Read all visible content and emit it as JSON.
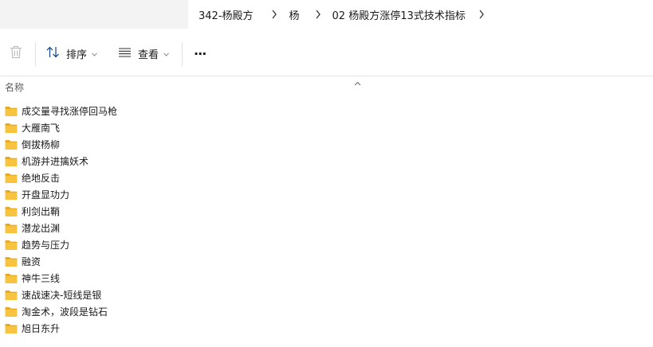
{
  "breadcrumb": [
    "342-杨殿方",
    "杨",
    "02 杨殿方涨停13式技术指标"
  ],
  "toolbar": {
    "delete_icon": "trash-icon",
    "sort_label": "排序",
    "view_label": "查看",
    "more_label": "···"
  },
  "column": {
    "name_header": "名称"
  },
  "folders": [
    "成交量寻找涨停回马枪",
    "大雁南飞",
    "倒拔杨柳",
    "机游并进擒妖术",
    "绝地反击",
    "开盘显功力",
    "利剑出鞘",
    "潜龙出渊",
    "趋势与压力",
    "融资",
    "神牛三线",
    "速战速决-短线是银",
    "淘金术，波段是钻石",
    "旭日东升"
  ],
  "colors": {
    "folder_yellow": "#f8c440",
    "folder_back": "#e8a817",
    "toolbar_text": "#1a1a1a",
    "disabled_icon": "#b8b8b8"
  }
}
